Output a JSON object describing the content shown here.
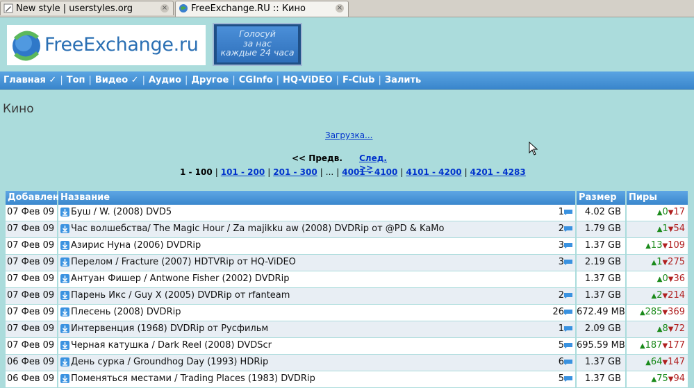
{
  "tabs": [
    {
      "title": "New style | userstyles.org",
      "active": false,
      "icon": "pencil-icon"
    },
    {
      "title": "FreeExchange.RU :: Кино",
      "active": true,
      "icon": "globe-icon"
    }
  ],
  "header": {
    "logo_text": "FreeExchange.ru",
    "vote_banner": [
      "Голосуй",
      "за нас",
      "каждые 24 часа"
    ]
  },
  "nav": [
    "Главная ✓",
    "Топ",
    "Видео ✓",
    "Аудио",
    "Другое",
    "CGInfo",
    "HQ-ViDEO",
    "F-Club",
    "Залить"
  ],
  "page_title": "Кино",
  "download_link": "Загрузка...",
  "prev_label": "<< Предв.",
  "next_label": "След. >>",
  "pager": {
    "current": "1 - 100",
    "pages": [
      "101 - 200",
      "201 - 300"
    ],
    "dots": "...",
    "tail_pages": [
      "4001 - 4100",
      "4101 - 4200",
      "4201 - 4283"
    ]
  },
  "table": {
    "headers": [
      "Добавлен",
      "Название",
      "Размер",
      "Пиры"
    ],
    "rows": [
      {
        "date": "07 Фев 09",
        "name": "Буш / W. (2008) DVD5",
        "comments": "1",
        "size": "4.02 GB",
        "seeders": "0",
        "leechers": "17"
      },
      {
        "date": "07 Фев 09",
        "name": "Час волшебства/ The Magic Hour / Za majikku aw (2008) DVDRip от @PD & KaMo",
        "comments": "2",
        "size": "1.79 GB",
        "seeders": "1",
        "leechers": "54"
      },
      {
        "date": "07 Фев 09",
        "name": "Азирис Нуна (2006) DVDRip",
        "comments": "3",
        "size": "1.37 GB",
        "seeders": "13",
        "leechers": "109"
      },
      {
        "date": "07 Фев 09",
        "name": "Перелом / Fracture (2007) HDTVRip от HQ-ViDEO",
        "comments": "3",
        "size": "2.19 GB",
        "seeders": "1",
        "leechers": "275"
      },
      {
        "date": "07 Фев 09",
        "name": "Антуан Фишер / Antwone Fisher (2002) DVDRip",
        "comments": "",
        "size": "1.37 GB",
        "seeders": "0",
        "leechers": "36"
      },
      {
        "date": "07 Фев 09",
        "name": "Парень Икс / Guy X (2005) DVDRip от rfanteam",
        "comments": "2",
        "size": "1.37 GB",
        "seeders": "2",
        "leechers": "214"
      },
      {
        "date": "07 Фев 09",
        "name": "Плесень (2008) DVDRip",
        "comments": "26",
        "size": "672.49 MB",
        "seeders": "285",
        "leechers": "369"
      },
      {
        "date": "07 Фев 09",
        "name": "Интервенция (1968) DVDRip от Русфильм",
        "comments": "1",
        "size": "2.09 GB",
        "seeders": "8",
        "leechers": "72"
      },
      {
        "date": "07 Фев 09",
        "name": "Черная катушка / Dark Reel (2008) DVDScr",
        "comments": "5",
        "size": "695.59 MB",
        "seeders": "187",
        "leechers": "177"
      },
      {
        "date": "06 Фев 09",
        "name": "День сурка / Groundhog Day (1993) HDRip",
        "comments": "6",
        "size": "1.37 GB",
        "seeders": "64",
        "leechers": "147"
      },
      {
        "date": "06 Фев 09",
        "name": "Поменяться местами / Trading Places (1983) DVDRip",
        "comments": "5",
        "size": "1.37 GB",
        "seeders": "75",
        "leechers": "94"
      }
    ]
  },
  "colors": {
    "background": "#abdcdc",
    "nav": "#3a86cc",
    "link": "#0033cc",
    "seed": "#1a8a1a",
    "leech": "#b02020"
  }
}
